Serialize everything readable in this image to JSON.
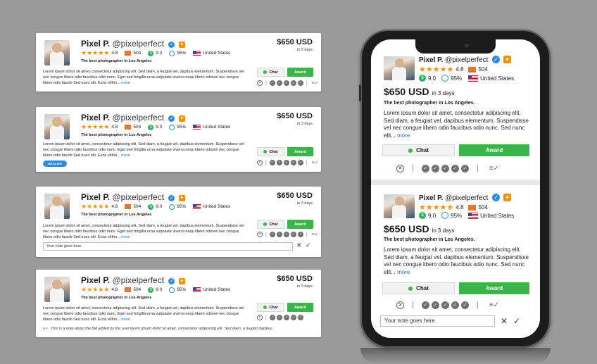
{
  "bid": {
    "name": "Pixel P.",
    "handle": "@pixelperfect",
    "verified_glyph": "✓",
    "pro_glyph": "✦",
    "stars": "★★★★★",
    "rating": "4.8",
    "reviews": "504",
    "score_glyph": "$",
    "score": "9.0",
    "completion": "95%",
    "country": "United States",
    "price": "$650 USD",
    "delivery": "in 3 days",
    "tagline": "The best photographer in Los Angeles",
    "description": "Lorem ipsum dolor sit amet, consectetur adipiscing elit. Sed diam, a feugiat vel, dapibus elementum. Suspendisse vel nec congue libero odio faucibus odio nunc. Eget sed fringilla urna vulputate viverra nequ libero odiovel nec congue libero odio faucib Sed nunc elit. Eunc elifrin...",
    "more": "more",
    "chat_label": "Chat",
    "award_label": "Award",
    "x_glyph": "✕",
    "check_glyph": "✓",
    "note_glyph": "≡✓"
  },
  "sealed_label": "SEALED",
  "note_placeholder": "Your note goes here",
  "note_cancel": "✕",
  "note_confirm": "✓",
  "note_text": "This is a note about the bid added by the user lorem ipsum dolor sit amet, consectetur adipiscing elit. Sed diam, a feugiat dapibus.",
  "mobile": {
    "price": "$650 USD",
    "delivery": "in 3 days",
    "tagline": "The best photographer in Los Angeles.",
    "description": "Lorem ipsum dolor sit amet, consectetur adipiscing elit. Sed diam, a feugiat vel, dapibus elementum. Suspendisse vel nec congue libero odio faucibus odio nunc. Sed nunc elit...",
    "more": "more"
  },
  "colors": {
    "accent_green": "#3ab54a",
    "accent_blue": "#2b8be0",
    "star_orange": "#f29200",
    "background": "#9a9a9a"
  }
}
